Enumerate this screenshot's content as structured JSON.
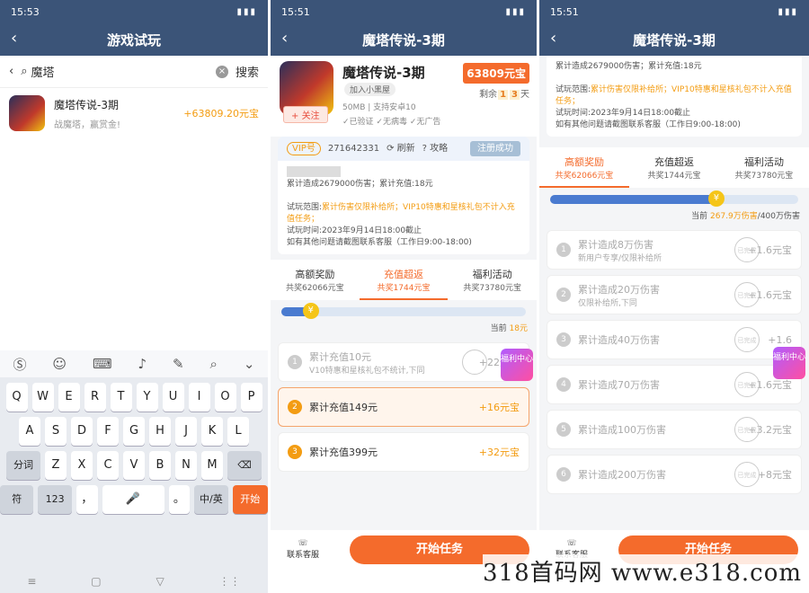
{
  "p1": {
    "time": "15:53",
    "title": "游戏试玩",
    "search_value": "魔塔",
    "search_btn": "搜索",
    "game": {
      "name": "魔塔传说-3期",
      "sub": "战魔塔，赢赏金!",
      "reward": "+63809.20元宝"
    },
    "rows": [
      [
        "Q",
        "W",
        "E",
        "R",
        "T",
        "Y",
        "U",
        "I",
        "O",
        "P"
      ],
      [
        "A",
        "S",
        "D",
        "F",
        "G",
        "H",
        "J",
        "K",
        "L"
      ]
    ],
    "row3_left": "分词",
    "row3": [
      "Z",
      "X",
      "C",
      "V",
      "B",
      "N",
      "M"
    ],
    "sym": "符",
    "num": "123",
    "comma": "，",
    "dot": "。",
    "lang": "中/英",
    "go": "开始"
  },
  "p2": {
    "time": "15:51",
    "title": "魔塔传说-3期",
    "game_name": "魔塔传说-3期",
    "blacklist": "加入小黑屋",
    "follow": "关注",
    "meta": "50MB | 支持安卓10",
    "tag1": "已验证",
    "tag2": "无病毒",
    "tag3": "无广告",
    "price": "63809元宝",
    "remain_pre": "剩余",
    "remain_a": "1",
    "remain_b": "3",
    "remain_post": "天",
    "vip_label": "VIP号",
    "vip_id": "271642331",
    "refresh": "刷新",
    "guide": "攻略",
    "registered": "注册成功",
    "stat": "累计造成2679000伤害；累计充值:18元",
    "scope_label": "试玩范围:",
    "scope": "累计伤害仅限补给所；VIP10特惠和星核礼包不计入充值任务；",
    "time_range": "试玩时间:2023年9月14日18:00截止",
    "contact": "如有其他问题请截图联系客服（工作日9:00-18:00)",
    "tabs": [
      {
        "t": "高额奖励",
        "s": "共奖62066元宝"
      },
      {
        "t": "充值超返",
        "s": "共奖1744元宝"
      },
      {
        "t": "福利活动",
        "s": "共奖73780元宝"
      }
    ],
    "progress": 0.12,
    "current_pre": "当前",
    "current_val": "18元",
    "tasks": [
      {
        "n": "1",
        "t": "累计充值10元",
        "sub": "V10特惠和星核礼包不统计,下同",
        "r": "+22元宝"
      },
      {
        "n": "2",
        "t": "累计充值149元",
        "r": "+16元宝"
      },
      {
        "n": "3",
        "t": "累计充值399元",
        "r": "+32元宝"
      }
    ],
    "service": "联系客服",
    "start": "开始任务",
    "fuli": "福利中心"
  },
  "p3": {
    "time": "15:51",
    "title": "魔塔传说-3期",
    "stat": "累计造成2679000伤害；累计充值:18元",
    "scope_label": "试玩范围:",
    "scope": "累计伤害仅限补给所；VIP10特惠和星核礼包不计入充值任务；",
    "time_range": "试玩时间:2023年9月14日18:00截止",
    "contact": "如有其他问题请截图联系客服（工作日9:00-18:00)",
    "tabs": [
      {
        "t": "高额奖励",
        "s": "共奖62066元宝"
      },
      {
        "t": "充值超返",
        "s": "共奖1744元宝"
      },
      {
        "t": "福利活动",
        "s": "共奖73780元宝"
      }
    ],
    "progress": 0.67,
    "current_pre": "当前",
    "current_val": "267.9万伤害",
    "current_total": "/400万伤害",
    "tasks": [
      {
        "n": "1",
        "t": "累计造成8万伤害",
        "sub": "新用户专享/仅限补给所",
        "r": "+1.6元宝"
      },
      {
        "n": "2",
        "t": "累计造成20万伤害",
        "sub": "仅限补给所,下同",
        "r": "+1.6元宝"
      },
      {
        "n": "3",
        "t": "累计造成40万伤害",
        "r": "+1.6"
      },
      {
        "n": "4",
        "t": "累计造成70万伤害",
        "r": "+1.6元宝"
      },
      {
        "n": "5",
        "t": "累计造成100万伤害",
        "r": "+3.2元宝"
      },
      {
        "n": "6",
        "t": "累计造成200万伤害",
        "r": "+8元宝"
      }
    ],
    "stamp": "已完成",
    "service": "联系客服",
    "start": "开始任务",
    "fuli": "福利中心"
  },
  "watermark": "318首码网 www.e318.com"
}
